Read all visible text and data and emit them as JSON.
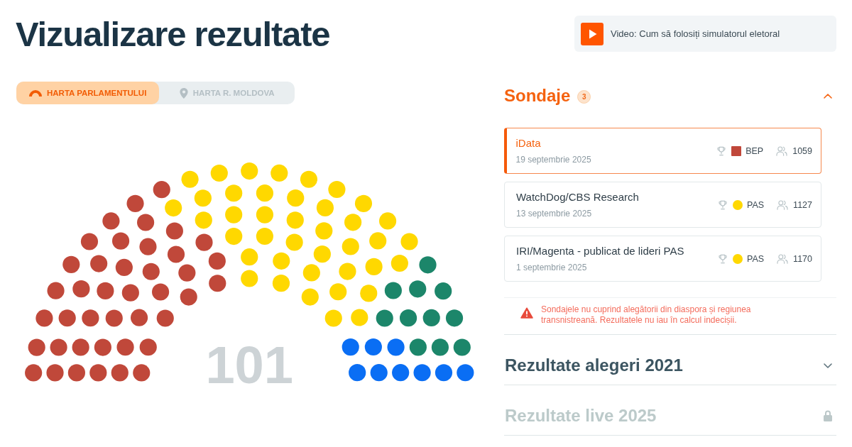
{
  "title": "Vizualizare rezultate",
  "video_button": {
    "label": "Video: Cum să folosiți simulatorul eletoral"
  },
  "map_tabs": [
    {
      "label": "HARTA PARLAMENTULUI",
      "selected": true
    },
    {
      "label": "HARTA R. MOLDOVA",
      "selected": false
    }
  ],
  "parliament": {
    "total": "101",
    "seats": [
      {
        "color": "#c0483a"
      },
      {
        "color": "#c0483a"
      },
      {
        "color": "#c0483a"
      },
      {
        "color": "#c0483a"
      },
      {
        "color": "#c0483a"
      },
      {
        "color": "#c0483a"
      },
      {
        "color": "#c0483a"
      },
      {
        "color": "#c0483a"
      },
      {
        "color": "#c0483a"
      },
      {
        "color": "#c0483a"
      },
      {
        "color": "#c0483a"
      },
      {
        "color": "#c0483a"
      },
      {
        "color": "#c0483a"
      },
      {
        "color": "#c0483a"
      },
      {
        "color": "#c0483a"
      },
      {
        "color": "#c0483a"
      },
      {
        "color": "#c0483a"
      },
      {
        "color": "#c0483a"
      },
      {
        "color": "#c0483a"
      },
      {
        "color": "#c0483a"
      },
      {
        "color": "#c0483a"
      },
      {
        "color": "#c0483a"
      },
      {
        "color": "#c0483a"
      },
      {
        "color": "#c0483a"
      },
      {
        "color": "#c0483a"
      },
      {
        "color": "#c0483a"
      },
      {
        "color": "#c0483a"
      },
      {
        "color": "#c0483a"
      },
      {
        "color": "#c0483a"
      },
      {
        "color": "#c0483a"
      },
      {
        "color": "#c0483a"
      },
      {
        "color": "#c0483a"
      },
      {
        "color": "#c0483a"
      },
      {
        "color": "#c0483a"
      },
      {
        "color": "#c0483a"
      },
      {
        "color": "#c0483a"
      },
      {
        "color": "#c0483a"
      },
      {
        "color": "#c0483a"
      },
      {
        "color": "#c0483a"
      },
      {
        "color": "#c0483a"
      },
      {
        "color": "#c0483a"
      },
      {
        "color": "#ffd800"
      },
      {
        "color": "#ffd800"
      },
      {
        "color": "#ffd800"
      },
      {
        "color": "#ffd800"
      },
      {
        "color": "#ffd800"
      },
      {
        "color": "#ffd800"
      },
      {
        "color": "#ffd800"
      },
      {
        "color": "#ffd800"
      },
      {
        "color": "#ffd800"
      },
      {
        "color": "#ffd800"
      },
      {
        "color": "#ffd800"
      },
      {
        "color": "#ffd800"
      },
      {
        "color": "#ffd800"
      },
      {
        "color": "#ffd800"
      },
      {
        "color": "#ffd800"
      },
      {
        "color": "#ffd800"
      },
      {
        "color": "#ffd800"
      },
      {
        "color": "#ffd800"
      },
      {
        "color": "#ffd800"
      },
      {
        "color": "#ffd800"
      },
      {
        "color": "#ffd800"
      },
      {
        "color": "#ffd800"
      },
      {
        "color": "#ffd800"
      },
      {
        "color": "#ffd800"
      },
      {
        "color": "#ffd800"
      },
      {
        "color": "#ffd800"
      },
      {
        "color": "#ffd800"
      },
      {
        "color": "#ffd800"
      },
      {
        "color": "#ffd800"
      },
      {
        "color": "#ffd800"
      },
      {
        "color": "#ffd800"
      },
      {
        "color": "#ffd800"
      },
      {
        "color": "#ffd800"
      },
      {
        "color": "#ffd800"
      },
      {
        "color": "#ffd800"
      },
      {
        "color": "#ffd800"
      },
      {
        "color": "#ffd800"
      },
      {
        "color": "#ffd800"
      },
      {
        "color": "#ffd800"
      },
      {
        "color": "#ffd800"
      },
      {
        "color": "#1c866a"
      },
      {
        "color": "#1c866a"
      },
      {
        "color": "#1c866a"
      },
      {
        "color": "#1c866a"
      },
      {
        "color": "#1c866a"
      },
      {
        "color": "#1c866a"
      },
      {
        "color": "#1c866a"
      },
      {
        "color": "#1c866a"
      },
      {
        "color": "#1c866a"
      },
      {
        "color": "#1c866a"
      },
      {
        "color": "#1c866a"
      },
      {
        "color": "#0a6ef4"
      },
      {
        "color": "#0a6ef4"
      },
      {
        "color": "#0a6ef4"
      },
      {
        "color": "#0a6ef4"
      },
      {
        "color": "#0a6ef4"
      },
      {
        "color": "#0a6ef4"
      },
      {
        "color": "#0a6ef4"
      },
      {
        "color": "#0a6ef4"
      },
      {
        "color": "#0a6ef4"
      }
    ]
  },
  "polls": {
    "title": "Sondaje",
    "count": "3",
    "expanded": true,
    "items": [
      {
        "name": "iData",
        "date": "19 septembrie 2025",
        "selected": true,
        "winner": {
          "kind": "square",
          "party": "BEP",
          "color": "#c0473a"
        },
        "sample": "1059"
      },
      {
        "name": "WatchDog/CBS Research",
        "date": "13 septembrie 2025",
        "selected": false,
        "winner": {
          "kind": "circle",
          "party": "PAS",
          "color": "#ffd800"
        },
        "sample": "1127"
      },
      {
        "name": "IRI/Magenta - publicat de lideri PAS",
        "date": "1 septembrie 2025",
        "selected": false,
        "winner": {
          "kind": "circle",
          "party": "PAS",
          "color": "#ffd800"
        },
        "sample": "1170"
      }
    ],
    "note": "Sondajele nu cuprind alegătorii din diaspora și regiunea transnistreană. Rezultatele nu iau în calcul indecișii."
  },
  "sections": [
    {
      "title": "Rezultate alegeri 2021",
      "locked": false,
      "expanded": false
    },
    {
      "title": "Rezultate live 2025",
      "locked": true
    }
  ]
}
